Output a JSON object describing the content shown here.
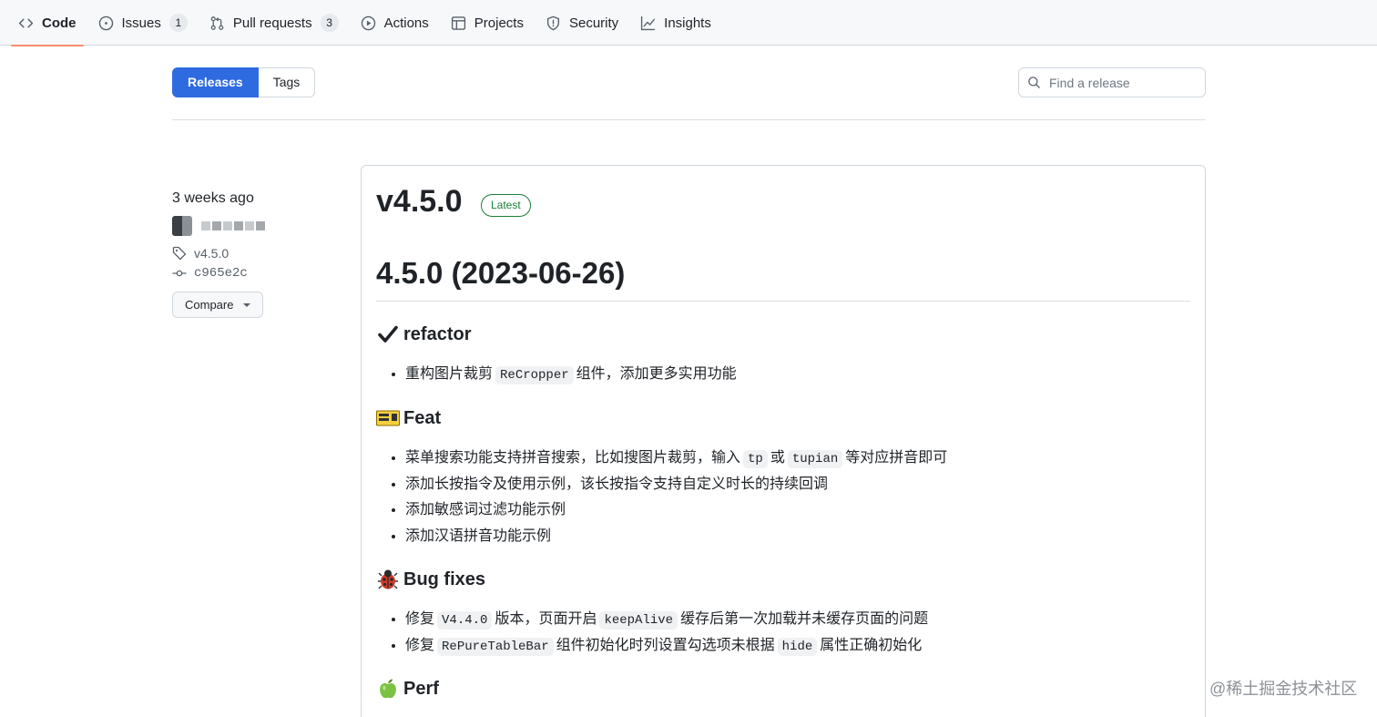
{
  "nav": {
    "items": [
      {
        "label": "Code",
        "icon": "code-icon",
        "active": true
      },
      {
        "label": "Issues",
        "icon": "issue-opened-icon",
        "count": "1"
      },
      {
        "label": "Pull requests",
        "icon": "git-pull-request-icon",
        "count": "3"
      },
      {
        "label": "Actions",
        "icon": "play-icon"
      },
      {
        "label": "Projects",
        "icon": "table-icon"
      },
      {
        "label": "Security",
        "icon": "shield-icon"
      },
      {
        "label": "Insights",
        "icon": "graph-icon"
      }
    ]
  },
  "subnav": {
    "releases_label": "Releases",
    "tags_label": "Tags",
    "search_placeholder": "Find a release"
  },
  "meta": {
    "date": "3 weeks ago",
    "tag": "v4.5.0",
    "commit": "c965e2c",
    "compare_label": "Compare"
  },
  "release": {
    "title": "v4.5.0",
    "badge": "Latest",
    "heading": "4.5.0 (2023-06-26)",
    "sections": {
      "refactor": {
        "icon": "check-mark-icon",
        "title": "refactor",
        "items": [
          {
            "a": "重构图片裁剪",
            "code1": "ReCropper",
            "b": "组件，添加更多实用功能"
          }
        ]
      },
      "feat": {
        "icon": "sparkle-sign-icon",
        "title": "Feat",
        "item1": {
          "a": "菜单搜索功能支持拼音搜索，比如搜图片裁剪，输入",
          "code1": "tp",
          "b": "或",
          "code2": "tupian",
          "c": "等对应拼音即可"
        },
        "item2": "添加长按指令及使用示例，该长按指令支持自定义时长的持续回调",
        "item3": "添加敏感词过滤功能示例",
        "item4": "添加汉语拼音功能示例"
      },
      "bugfixes": {
        "icon": "ladybug-icon",
        "title": "Bug fixes",
        "item1": {
          "a": "修复",
          "code1": "V4.4.0",
          "b": "版本，页面开启",
          "code2": "keepAlive",
          "c": "缓存后第一次加载并未缓存页面的问题"
        },
        "item2": {
          "a": "修复",
          "code1": "RePureTableBar",
          "b": "组件初始化时列设置勾选项未根据",
          "code2": "hide",
          "c": "属性正确初始化"
        }
      },
      "perf": {
        "icon": "green-apple-icon",
        "title": "Perf"
      }
    }
  },
  "watermark": "@稀土掘金技术社区",
  "colors": {
    "primary_button": "#2f6be0",
    "latest_badge": "#1a7f37",
    "active_tab_underline": "#fd8c73"
  }
}
